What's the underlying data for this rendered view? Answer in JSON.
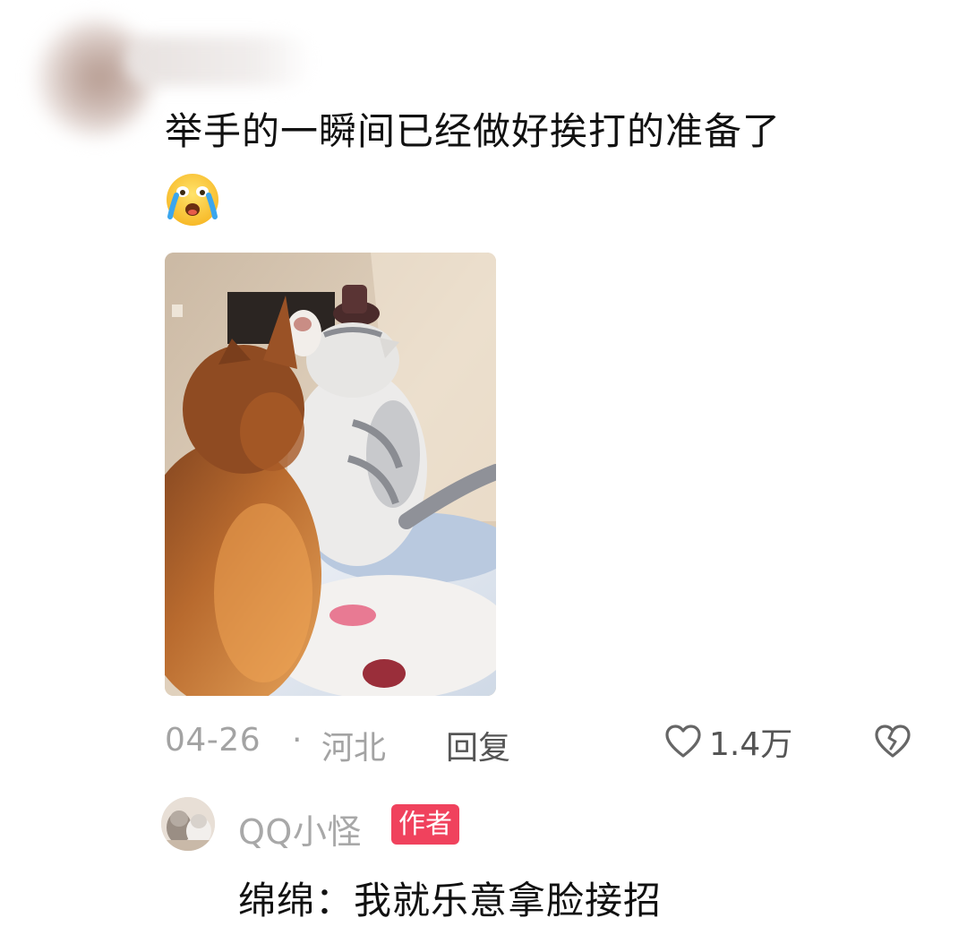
{
  "comment": {
    "text": "举手的一瞬间已经做好挨打的准备了",
    "emoji_icon": "crying-face-icon"
  },
  "meta": {
    "date": "04-26",
    "separator": "·",
    "location": "河北",
    "reply_label": "回复",
    "like_count": "1.4万"
  },
  "reply": {
    "username": "QQ小怪",
    "badge": "作者",
    "text": "绵绵：我就乐意拿脸接招"
  },
  "colors": {
    "badge": "#f0425d",
    "meta_text": "#a3a3a3",
    "action_text": "#555555"
  }
}
